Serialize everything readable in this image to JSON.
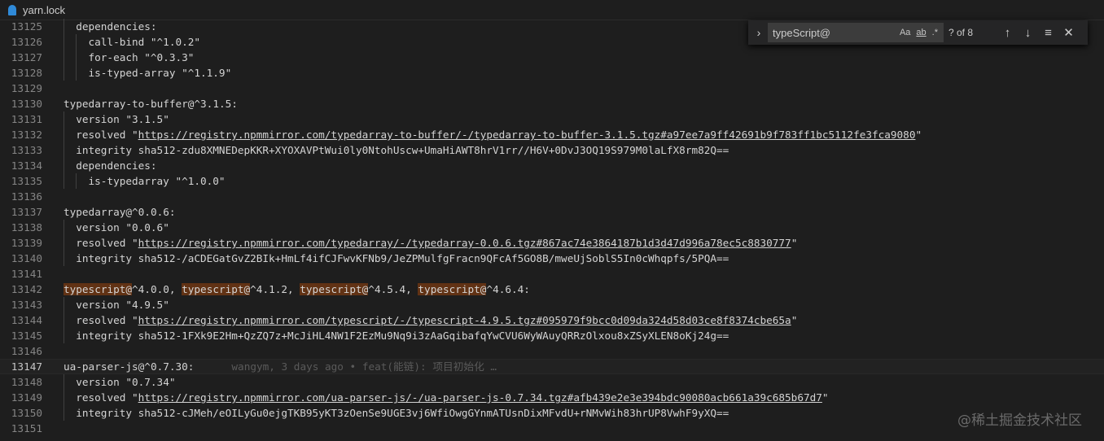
{
  "tab": {
    "filename": "yarn.lock",
    "icon": "yarn-icon"
  },
  "find_widget": {
    "query": "typeScript@",
    "match_case_label": "Aa",
    "whole_word_label": "ab",
    "regex_label": ".*",
    "count": "? of 8",
    "expand_icon": "chevron-right-icon",
    "prev_icon": "arrow-up-icon",
    "next_icon": "arrow-down-icon",
    "selection_icon": "find-in-selection-icon",
    "close_icon": "close-icon"
  },
  "blame": "wangym, 3 days ago • feat(能链): 项目初始化 …",
  "watermark": "@稀土掘金技术社区",
  "current_line": "13147",
  "lines": [
    {
      "n": "13125",
      "indent": 1,
      "segs": [
        {
          "t": "dependencies:"
        }
      ]
    },
    {
      "n": "13126",
      "indent": 2,
      "segs": [
        {
          "t": "call-bind \"^1.0.2\""
        }
      ]
    },
    {
      "n": "13127",
      "indent": 2,
      "segs": [
        {
          "t": "for-each \"^0.3.3\""
        }
      ]
    },
    {
      "n": "13128",
      "indent": 2,
      "segs": [
        {
          "t": "is-typed-array \"^1.1.9\""
        }
      ]
    },
    {
      "n": "13129",
      "indent": 0,
      "segs": []
    },
    {
      "n": "13130",
      "indent": 0,
      "segs": [
        {
          "t": "typedarray-to-buffer@^3.1.5:"
        }
      ]
    },
    {
      "n": "13131",
      "indent": 1,
      "segs": [
        {
          "t": "version \"3.1.5\""
        }
      ]
    },
    {
      "n": "13132",
      "indent": 1,
      "segs": [
        {
          "t": "resolved \""
        },
        {
          "t": "https://registry.npmmirror.com/typedarray-to-buffer/-/typedarray-to-buffer-3.1.5.tgz#a97ee7a9ff42691b9f783ff1bc5112fe3fca9080",
          "c": "link"
        },
        {
          "t": "\""
        }
      ]
    },
    {
      "n": "13133",
      "indent": 1,
      "segs": [
        {
          "t": "integrity sha512-zdu8XMNEDepKKR+XYOXAVPtWui0ly0NtohUscw+UmaHiAWT8hrV1rr//H6V+0DvJ3OQ19S979M0laLfX8rm82Q=="
        }
      ]
    },
    {
      "n": "13134",
      "indent": 1,
      "segs": [
        {
          "t": "dependencies:"
        }
      ]
    },
    {
      "n": "13135",
      "indent": 2,
      "segs": [
        {
          "t": "is-typedarray \"^1.0.0\""
        }
      ]
    },
    {
      "n": "13136",
      "indent": 0,
      "segs": []
    },
    {
      "n": "13137",
      "indent": 0,
      "segs": [
        {
          "t": "typedarray@^0.0.6:"
        }
      ]
    },
    {
      "n": "13138",
      "indent": 1,
      "segs": [
        {
          "t": "version \"0.0.6\""
        }
      ]
    },
    {
      "n": "13139",
      "indent": 1,
      "segs": [
        {
          "t": "resolved \""
        },
        {
          "t": "https://registry.npmmirror.com/typedarray/-/typedarray-0.0.6.tgz#867ac74e3864187b1d3d47d996a78ec5c8830777",
          "c": "link"
        },
        {
          "t": "\""
        }
      ]
    },
    {
      "n": "13140",
      "indent": 1,
      "segs": [
        {
          "t": "integrity sha512-/aCDEGatGvZ2BIk+HmLf4ifCJFwvKFNb9/JeZPMulfgFracn9QFcAf5GO8B/mweUjSoblS5In0cWhqpfs/5PQA=="
        }
      ]
    },
    {
      "n": "13141",
      "indent": 0,
      "segs": []
    },
    {
      "n": "13142",
      "indent": 0,
      "segs": [
        {
          "t": "typescript@",
          "c": "match"
        },
        {
          "t": "^4.0.0, "
        },
        {
          "t": "typescript@",
          "c": "match"
        },
        {
          "t": "^4.1.2, "
        },
        {
          "t": "typescript@",
          "c": "match"
        },
        {
          "t": "^4.5.4, "
        },
        {
          "t": "typescript@",
          "c": "match"
        },
        {
          "t": "^4.6.4:"
        }
      ]
    },
    {
      "n": "13143",
      "indent": 1,
      "segs": [
        {
          "t": "version \"4.9.5\""
        }
      ]
    },
    {
      "n": "13144",
      "indent": 1,
      "segs": [
        {
          "t": "resolved \""
        },
        {
          "t": "https://registry.npmmirror.com/typescript/-/typescript-4.9.5.tgz#095979f9bcc0d09da324d58d03ce8f8374cbe65a",
          "c": "link"
        },
        {
          "t": "\""
        }
      ]
    },
    {
      "n": "13145",
      "indent": 1,
      "segs": [
        {
          "t": "integrity sha512-1FXk9E2Hm+QzZQ7z+McJiHL4NW1F2EzMu9Nq9i3zAaGqibafqYwCVU6WyWAuyQRRzOlxou8xZSyXLEN8oKj24g=="
        }
      ]
    },
    {
      "n": "13146",
      "indent": 0,
      "segs": []
    },
    {
      "n": "13147",
      "indent": 0,
      "segs": [
        {
          "t": "ua-parser-js@^0.7.30:"
        }
      ],
      "blame": true
    },
    {
      "n": "13148",
      "indent": 1,
      "segs": [
        {
          "t": "version \"0.7.34\""
        }
      ]
    },
    {
      "n": "13149",
      "indent": 1,
      "segs": [
        {
          "t": "resolved \""
        },
        {
          "t": "https://registry.npmmirror.com/ua-parser-js/-/ua-parser-js-0.7.34.tgz#afb439e2e3e394bdc90080acb661a39c685b67d7",
          "c": "link"
        },
        {
          "t": "\""
        }
      ]
    },
    {
      "n": "13150",
      "indent": 1,
      "segs": [
        {
          "t": "integrity sha512-cJMeh/eOILyGu0ejgTKB95yKT3zOenSe9UGE3vj6WfiOwgGYnmATUsnDixMFvdU+rNMvWih83hrUP8VwhF9yXQ=="
        }
      ]
    },
    {
      "n": "13151",
      "indent": 0,
      "segs": []
    }
  ]
}
